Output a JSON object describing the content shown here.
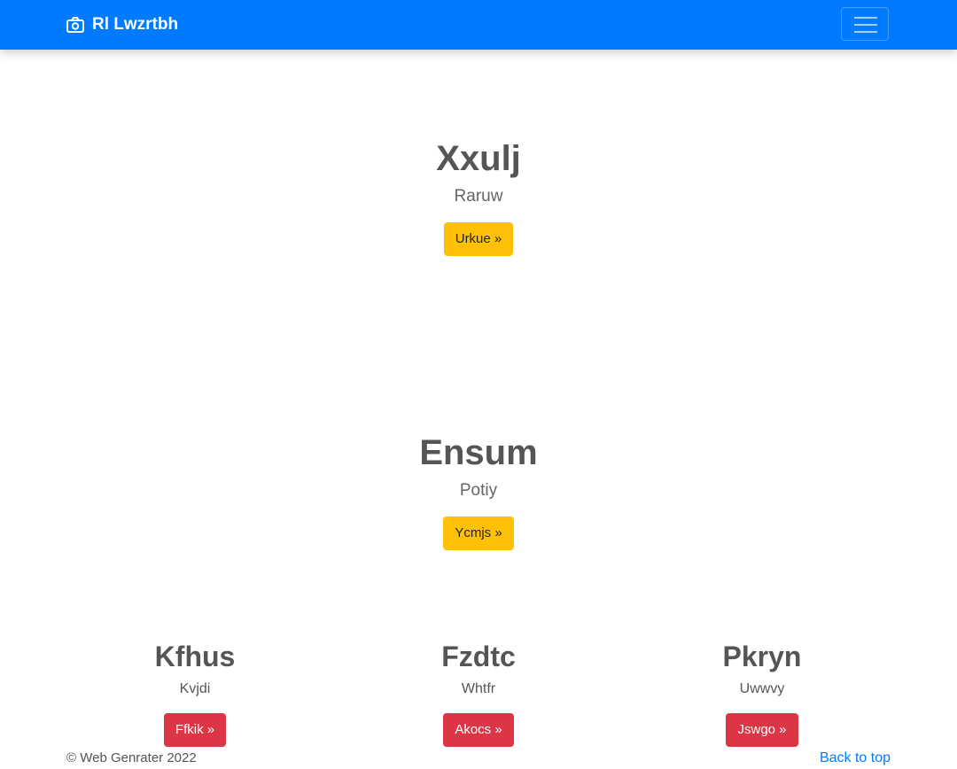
{
  "navbar": {
    "brand": "Rl Lwzrtbh",
    "brand_icon": "camera-icon",
    "toggler_icon": "hamburger-menu-icon",
    "background": "#007bff"
  },
  "sections": [
    {
      "title": "Xxulj",
      "subtitle": "Raruw",
      "button": "Urkue »"
    },
    {
      "title": "Ensum",
      "subtitle": "Potiy",
      "button": "Ycmjs »"
    }
  ],
  "columns": [
    {
      "title": "Kfhus",
      "text": "Kvjdi",
      "button": "Ffkik »"
    },
    {
      "title": "Fzdtc",
      "text": "Whtfr",
      "button": "Akocs »"
    },
    {
      "title": "Pkryn",
      "text": "Uwwvy",
      "button": "Jswgo »"
    }
  ],
  "footer": {
    "copyright": "© Web Genrater 2022",
    "back_to_top": "Back to top"
  },
  "colors": {
    "primary": "#007bff",
    "warning": "#ffc107",
    "danger": "#dc3545"
  }
}
